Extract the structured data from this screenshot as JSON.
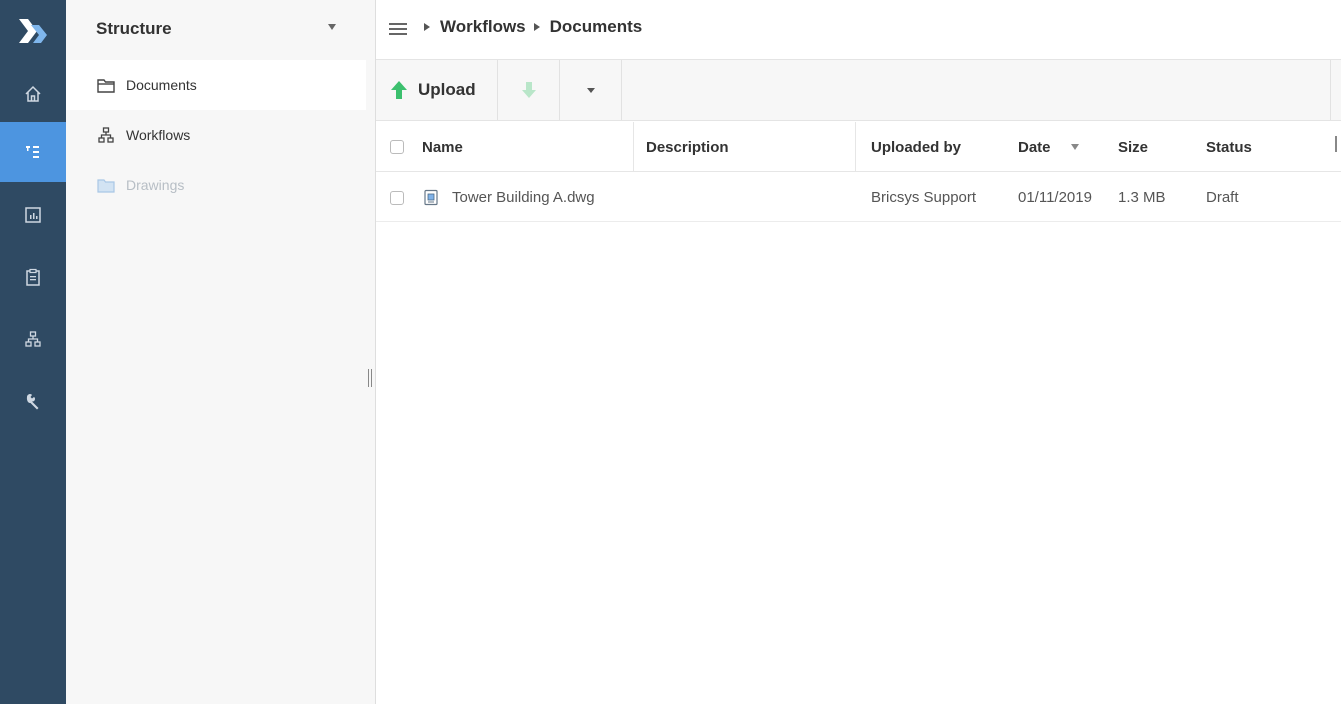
{
  "rail": {
    "items": [
      {
        "name": "home",
        "icon": "home-icon"
      },
      {
        "name": "structure",
        "icon": "tree-icon",
        "active": true
      },
      {
        "name": "reports",
        "icon": "chart-icon"
      },
      {
        "name": "clipboard",
        "icon": "clipboard-icon"
      },
      {
        "name": "workflows",
        "icon": "hierarchy-icon"
      },
      {
        "name": "tools",
        "icon": "wrench-icon"
      }
    ],
    "accent": "#4d95e0",
    "background": "#2f4a63"
  },
  "structure": {
    "title": "Structure",
    "items": [
      {
        "label": "Documents",
        "icon": "folder-icon",
        "selected": true
      },
      {
        "label": "Workflows",
        "icon": "hierarchy-icon"
      },
      {
        "label": "Drawings",
        "icon": "folder-icon",
        "disabled": true
      }
    ]
  },
  "breadcrumb": {
    "items": [
      "Workflows",
      "Documents"
    ]
  },
  "toolbar": {
    "upload_label": "Upload",
    "upload_icon": "arrow-up-icon",
    "download_icon": "arrow-down-icon",
    "more_icon": "chevron-down-icon"
  },
  "table": {
    "columns": {
      "name": "Name",
      "description": "Description",
      "uploaded_by": "Uploaded by",
      "date": "Date",
      "size": "Size",
      "status": "Status"
    },
    "rows": [
      {
        "name": "Tower Building A.dwg",
        "description": "",
        "uploaded_by": "Bricsys Support",
        "date": "01/11/2019",
        "size": "1.3 MB",
        "status": "Draft"
      }
    ]
  }
}
